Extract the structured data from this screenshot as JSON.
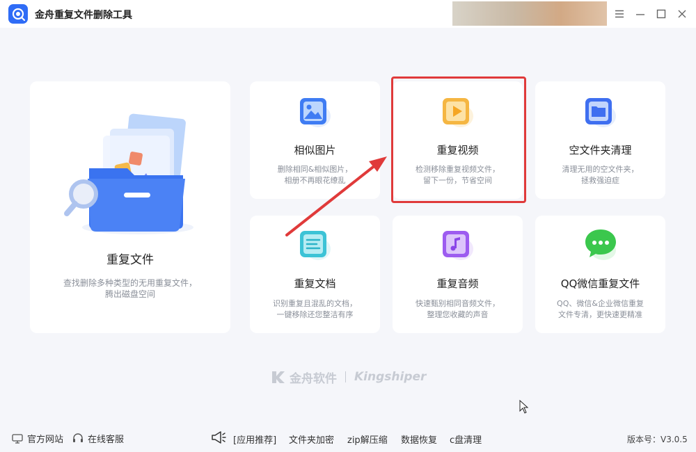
{
  "window": {
    "title": "金舟重复文件删除工具"
  },
  "cards": {
    "main": {
      "title": "重复文件",
      "desc_line1": "查找删除多种类型的无用重复文件，",
      "desc_line2": "腾出磁盘空间"
    },
    "similar_images": {
      "title": "相似图片",
      "desc_line1": "删除相同&相似图片，",
      "desc_line2": "相册不再眼花缭乱"
    },
    "duplicate_video": {
      "title": "重复视频",
      "desc_line1": "检测移除重复视频文件，",
      "desc_line2": "留下一份，节省空间"
    },
    "empty_folder": {
      "title": "空文件夹清理",
      "desc_line1": "清理无用的空文件夹，",
      "desc_line2": "拯救强迫症"
    },
    "duplicate_docs": {
      "title": "重复文档",
      "desc_line1": "识别重复且混乱的文档，",
      "desc_line2": "一键移除还您整洁有序"
    },
    "duplicate_audio": {
      "title": "重复音频",
      "desc_line1": "快速甄别相同音频文件，",
      "desc_line2": "整理您收藏的声音"
    },
    "qq_wechat": {
      "title": "QQ微信重复文件",
      "desc_line1": "QQ、微信&企业微信重复",
      "desc_line2": "文件专清，更快速更精准"
    }
  },
  "brand": {
    "cn": "金舟软件",
    "en": "Kingshiper"
  },
  "footer": {
    "official_site": "官方网站",
    "online_service": "在线客服",
    "app_recommend": "[应用推荐]",
    "folder_encrypt": "文件夹加密",
    "zip": "zip解压缩",
    "data_recovery": "数据恢复",
    "c_clean": "c盘清理",
    "version": "版本号：V3.0.5"
  },
  "colors": {
    "accent": "#2f6cf6",
    "highlight": "#e03a3a"
  }
}
